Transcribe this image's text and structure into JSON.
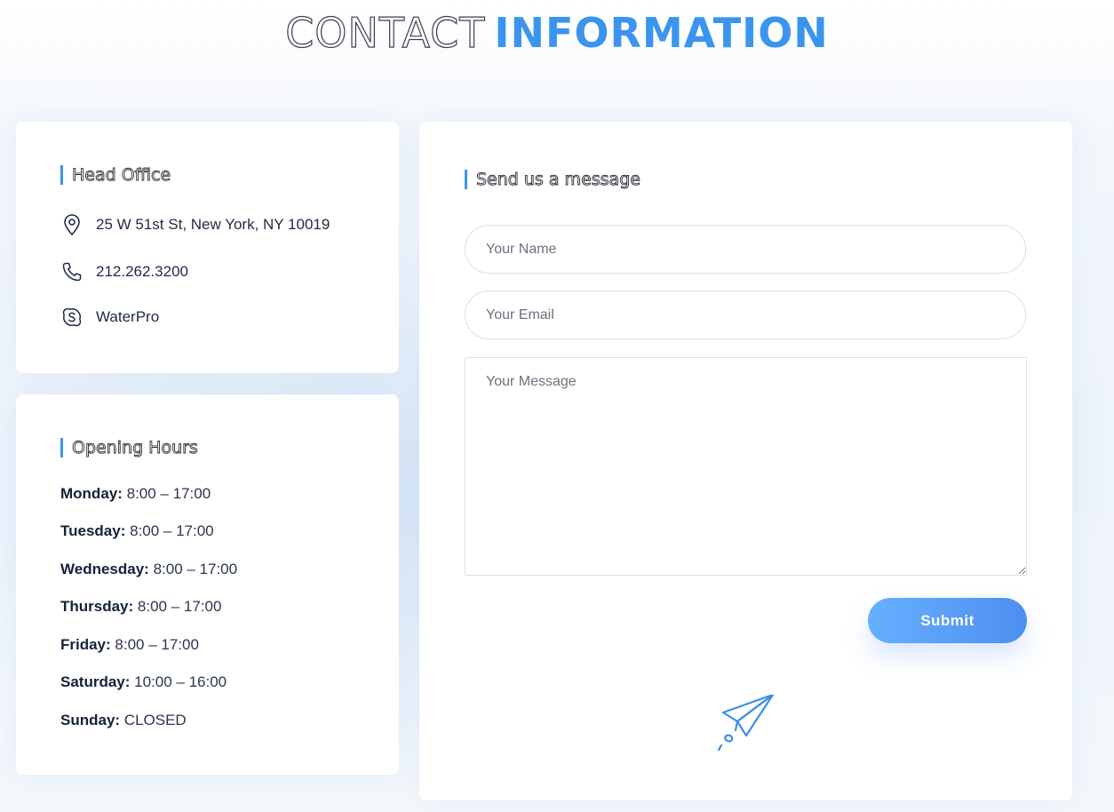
{
  "heading": {
    "part1": "CONTACT",
    "part2": "INFORMATION"
  },
  "head_office": {
    "title": "Head Office",
    "address": "25 W 51st St, New York, NY 10019",
    "phone": "212.262.3200",
    "skype": "WaterPro"
  },
  "opening_hours": {
    "title": "Opening Hours",
    "days": [
      {
        "day": "Monday:",
        "hours": "8:00 – 17:00"
      },
      {
        "day": "Tuesday:",
        "hours": "8:00 – 17:00"
      },
      {
        "day": "Wednesday:",
        "hours": "8:00 – 17:00"
      },
      {
        "day": "Thursday:",
        "hours": "8:00 – 17:00"
      },
      {
        "day": "Friday:",
        "hours": "8:00 – 17:00"
      },
      {
        "day": "Saturday:",
        "hours": "10:00 – 16:00"
      },
      {
        "day": "Sunday:",
        "hours": "CLOSED"
      }
    ]
  },
  "form": {
    "title": "Send us a message",
    "name_placeholder": "Your Name",
    "email_placeholder": "Your Email",
    "message_placeholder": "Your Message",
    "submit_label": "Submit"
  },
  "colors": {
    "accent": "#3b95ee",
    "button_start": "#66b0ff",
    "button_end": "#4d8ef0"
  },
  "icons": [
    "map-pin-icon",
    "phone-icon",
    "skype-icon",
    "paper-plane-icon"
  ]
}
